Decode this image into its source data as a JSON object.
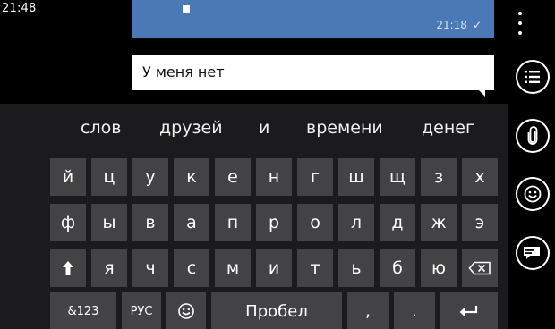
{
  "status": {
    "time": "21:48"
  },
  "sent_bubble": {
    "time": "21:18"
  },
  "compose": {
    "text": "У меня нет"
  },
  "suggestions": [
    "слов",
    "друзей",
    "и",
    "времени",
    "денег"
  ],
  "keyboard": {
    "row1": [
      "й",
      "ц",
      "у",
      "к",
      "е",
      "н",
      "г",
      "ш",
      "щ",
      "з",
      "х"
    ],
    "row2": [
      "ф",
      "ы",
      "в",
      "а",
      "п",
      "р",
      "о",
      "л",
      "д",
      "ж",
      "э"
    ],
    "row3": [
      "я",
      "ч",
      "с",
      "м",
      "и",
      "т",
      "ь",
      "б",
      "ю"
    ],
    "symbols_label": "&123",
    "lang_label": "РУС",
    "space_label": "Пробел",
    "comma": ",",
    "period": "."
  },
  "icons": {
    "shift": "shift-arrow-icon",
    "backspace": "backspace-icon",
    "enter": "enter-icon",
    "emoji": "emoji-icon",
    "more": "more-dots-icon",
    "list": "list-icon",
    "attach": "paperclip-icon",
    "smiley": "smiley-icon",
    "send": "send-message-icon"
  },
  "colors": {
    "sent_bubble": "#4a79b5",
    "keyboard_bg": "#1b1b1d",
    "key_bg": "#434345"
  }
}
